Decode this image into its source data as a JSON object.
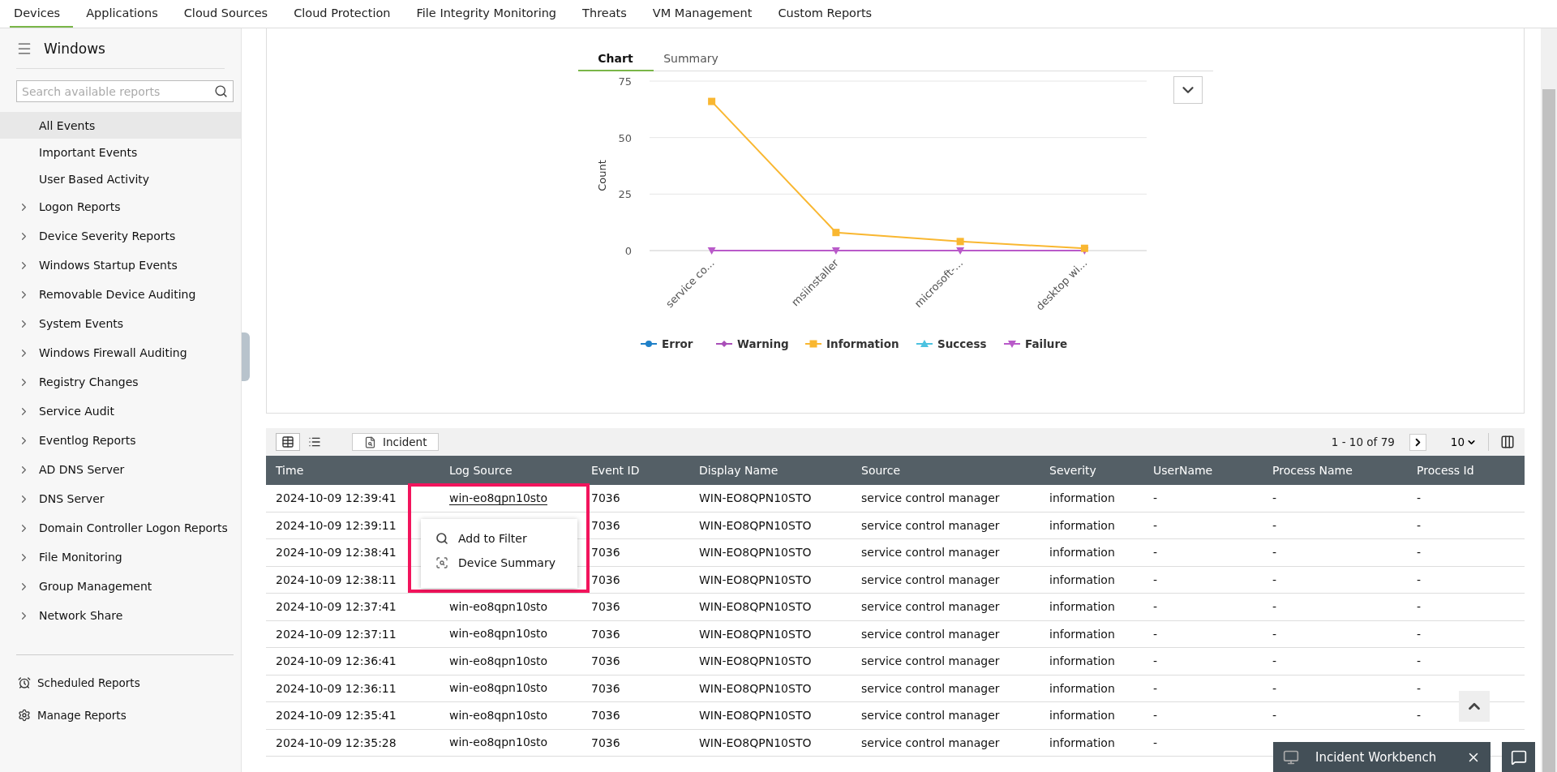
{
  "top_nav": [
    {
      "label": "Devices",
      "selected": true
    },
    {
      "label": "Applications",
      "selected": false
    },
    {
      "label": "Cloud Sources",
      "selected": false
    },
    {
      "label": "Cloud Protection",
      "selected": false
    },
    {
      "label": "File Integrity Monitoring",
      "selected": false
    },
    {
      "label": "Threats",
      "selected": false
    },
    {
      "label": "VM Management",
      "selected": false
    },
    {
      "label": "Custom Reports",
      "selected": false
    }
  ],
  "sidebar": {
    "title": "Windows",
    "search": {
      "placeholder": "Search available reports"
    },
    "items": [
      {
        "label": "All Events",
        "kind": "leaf",
        "selected": true
      },
      {
        "label": "Important Events",
        "kind": "leaf",
        "selected": false
      },
      {
        "label": "User Based Activity",
        "kind": "leaf",
        "selected": false
      },
      {
        "label": "Logon Reports",
        "kind": "group",
        "selected": false
      },
      {
        "label": "Device Severity Reports",
        "kind": "group",
        "selected": false
      },
      {
        "label": "Windows Startup Events",
        "kind": "group",
        "selected": false
      },
      {
        "label": "Removable Device Auditing",
        "kind": "group",
        "selected": false
      },
      {
        "label": "System Events",
        "kind": "group",
        "selected": false
      },
      {
        "label": "Windows Firewall Auditing",
        "kind": "group",
        "selected": false
      },
      {
        "label": "Registry Changes",
        "kind": "group",
        "selected": false
      },
      {
        "label": "Service Audit",
        "kind": "group",
        "selected": false
      },
      {
        "label": "Eventlog Reports",
        "kind": "group",
        "selected": false
      },
      {
        "label": "AD DNS Server",
        "kind": "group",
        "selected": false
      },
      {
        "label": "DNS Server",
        "kind": "group",
        "selected": false
      },
      {
        "label": "Domain Controller Logon Reports",
        "kind": "group",
        "selected": false
      },
      {
        "label": "File Monitoring",
        "kind": "group",
        "selected": false
      },
      {
        "label": "Group Management",
        "kind": "group",
        "selected": false
      },
      {
        "label": "Network Share",
        "kind": "group",
        "selected": false
      }
    ],
    "footer": [
      {
        "label": "Scheduled Reports",
        "kind": "schedule"
      },
      {
        "label": "Manage Reports",
        "kind": "manage"
      }
    ]
  },
  "chart_panel": {
    "tabs": [
      {
        "label": "Chart",
        "selected": true
      },
      {
        "label": "Summary",
        "selected": false
      }
    ],
    "chart_data": {
      "type": "line",
      "legend": "bottom",
      "ylabel": "Count",
      "categories": [
        "service co...",
        "msiinstaller",
        "microsoft-...",
        "desktop wi..."
      ],
      "ylim": [
        0,
        75
      ],
      "yticks": [
        0,
        25,
        50,
        75
      ],
      "series": [
        {
          "name": "Error",
          "color": "#1f80c8",
          "marker": "circle",
          "values": [
            null,
            null,
            null,
            null
          ]
        },
        {
          "name": "Warning",
          "color": "#a94fb8",
          "marker": "diamond",
          "values": [
            null,
            null,
            null,
            null
          ]
        },
        {
          "name": "Information",
          "color": "#f9b731",
          "marker": "square",
          "values": [
            66,
            8,
            4,
            1
          ]
        },
        {
          "name": "Success",
          "color": "#4cc2e0",
          "marker": "triangle",
          "values": [
            null,
            null,
            null,
            null
          ]
        },
        {
          "name": "Failure",
          "color": "#b95ac9",
          "marker": "triangle-down",
          "values": [
            0,
            0,
            0,
            0
          ]
        }
      ]
    }
  },
  "table": {
    "toolbar": {
      "views": [
        {
          "kind": "grid",
          "selected": true
        },
        {
          "kind": "list",
          "selected": false
        }
      ],
      "incident_button": "Incident",
      "pagination": "1 - 10 of 79",
      "page_size": "10"
    },
    "columns": [
      "Time",
      "Log Source",
      "Event ID",
      "Display Name",
      "Source",
      "Severity",
      "UserName",
      "Process Name",
      "Process Id"
    ],
    "rows": [
      {
        "time": "2024-10-09 12:39:41",
        "log_source": "win-eo8qpn10sto",
        "linked": true,
        "event_id": "7036",
        "display_name": "WIN-EO8QPN10STO",
        "source": "service control manager",
        "severity": "information",
        "username": "-",
        "process_name": "-",
        "process_id": "-"
      },
      {
        "time": "2024-10-09 12:39:11",
        "event_id": "7036",
        "display_name": "WIN-EO8QPN10STO",
        "source": "service control manager",
        "severity": "information",
        "username": "-",
        "process_name": "-",
        "process_id": "-"
      },
      {
        "time": "2024-10-09 12:38:41",
        "event_id": "7036",
        "display_name": "WIN-EO8QPN10STO",
        "source": "service control manager",
        "severity": "information",
        "username": "-",
        "process_name": "-",
        "process_id": "-"
      },
      {
        "time": "2024-10-09 12:38:11",
        "event_id": "7036",
        "display_name": "WIN-EO8QPN10STO",
        "source": "service control manager",
        "severity": "information",
        "username": "-",
        "process_name": "-",
        "process_id": "-"
      },
      {
        "time": "2024-10-09 12:37:41",
        "log_source": "win-eo8qpn10sto",
        "linked": false,
        "event_id": "7036",
        "display_name": "WIN-EO8QPN10STO",
        "source": "service control manager",
        "severity": "information",
        "username": "-",
        "process_name": "-",
        "process_id": "-"
      },
      {
        "time": "2024-10-09 12:37:11",
        "log_source": "win-eo8qpn10sto",
        "linked": false,
        "event_id": "7036",
        "display_name": "WIN-EO8QPN10STO",
        "source": "service control manager",
        "severity": "information",
        "username": "-",
        "process_name": "-",
        "process_id": "-"
      },
      {
        "time": "2024-10-09 12:36:41",
        "log_source": "win-eo8qpn10sto",
        "linked": false,
        "event_id": "7036",
        "display_name": "WIN-EO8QPN10STO",
        "source": "service control manager",
        "severity": "information",
        "username": "-",
        "process_name": "-",
        "process_id": "-"
      },
      {
        "time": "2024-10-09 12:36:11",
        "log_source": "win-eo8qpn10sto",
        "linked": false,
        "event_id": "7036",
        "display_name": "WIN-EO8QPN10STO",
        "source": "service control manager",
        "severity": "information",
        "username": "-",
        "process_name": "-",
        "process_id": "-"
      },
      {
        "time": "2024-10-09 12:35:41",
        "log_source": "win-eo8qpn10sto",
        "linked": false,
        "event_id": "7036",
        "display_name": "WIN-EO8QPN10STO",
        "source": "service control manager",
        "severity": "information",
        "username": "-",
        "process_name": "-",
        "process_id": "-"
      },
      {
        "time": "2024-10-09 12:35:28",
        "log_source": "win-eo8qpn10sto",
        "linked": false,
        "event_id": "7036",
        "display_name": "WIN-EO8QPN10STO",
        "source": "service control manager",
        "severity": "information",
        "username": "-"
      }
    ]
  },
  "popup": {
    "items": [
      {
        "label": "Add to Filter",
        "kind": "filter"
      },
      {
        "label": "Device Summary",
        "kind": "summary"
      }
    ]
  },
  "incident_workbench": {
    "label": "Incident Workbench"
  }
}
